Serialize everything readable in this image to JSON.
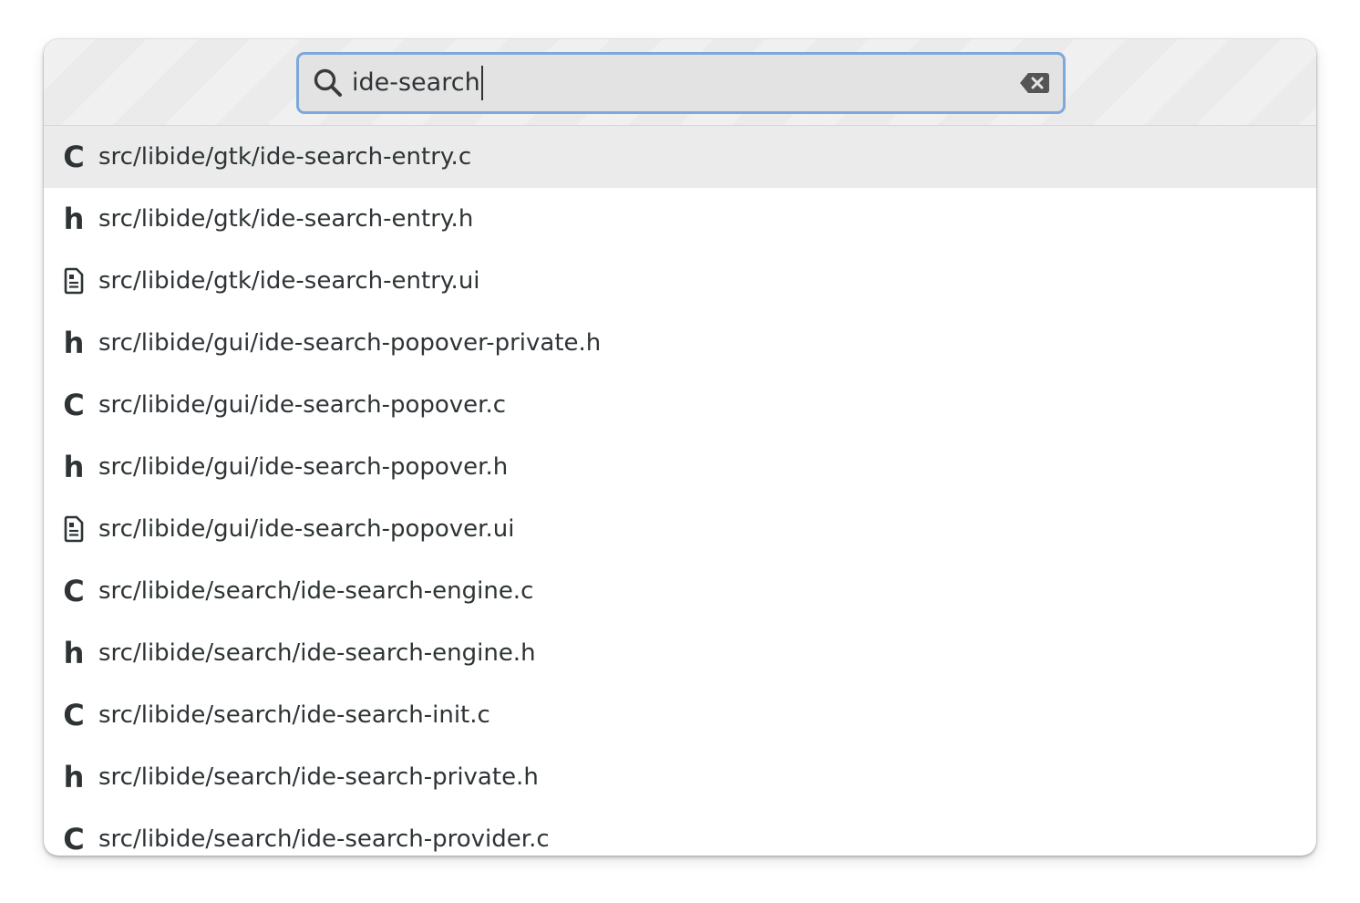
{
  "search": {
    "query": "ide-search",
    "search_icon": "search-icon",
    "clear_icon": "edit-clear-icon"
  },
  "results": [
    {
      "type": "c",
      "glyph": "C",
      "icon": "c-source-icon",
      "path": "src/libide/gtk/ide-search-entry.c",
      "selected": true
    },
    {
      "type": "h",
      "glyph": "h",
      "icon": "c-header-icon",
      "path": "src/libide/gtk/ide-search-entry.h",
      "selected": false
    },
    {
      "type": "ui",
      "glyph": "",
      "icon": "ui-file-icon",
      "path": "src/libide/gtk/ide-search-entry.ui",
      "selected": false
    },
    {
      "type": "h",
      "glyph": "h",
      "icon": "c-header-icon",
      "path": "src/libide/gui/ide-search-popover-private.h",
      "selected": false
    },
    {
      "type": "c",
      "glyph": "C",
      "icon": "c-source-icon",
      "path": "src/libide/gui/ide-search-popover.c",
      "selected": false
    },
    {
      "type": "h",
      "glyph": "h",
      "icon": "c-header-icon",
      "path": "src/libide/gui/ide-search-popover.h",
      "selected": false
    },
    {
      "type": "ui",
      "glyph": "",
      "icon": "ui-file-icon",
      "path": "src/libide/gui/ide-search-popover.ui",
      "selected": false
    },
    {
      "type": "c",
      "glyph": "C",
      "icon": "c-source-icon",
      "path": "src/libide/search/ide-search-engine.c",
      "selected": false
    },
    {
      "type": "h",
      "glyph": "h",
      "icon": "c-header-icon",
      "path": "src/libide/search/ide-search-engine.h",
      "selected": false
    },
    {
      "type": "c",
      "glyph": "C",
      "icon": "c-source-icon",
      "path": "src/libide/search/ide-search-init.c",
      "selected": false
    },
    {
      "type": "h",
      "glyph": "h",
      "icon": "c-header-icon",
      "path": "src/libide/search/ide-search-private.h",
      "selected": false
    },
    {
      "type": "c",
      "glyph": "C",
      "icon": "c-source-icon",
      "path": "src/libide/search/ide-search-provider.c",
      "selected": false
    }
  ],
  "colors": {
    "accent": "#7ea8dc",
    "text": "#2e3436",
    "selected_row": "#ebebeb"
  }
}
